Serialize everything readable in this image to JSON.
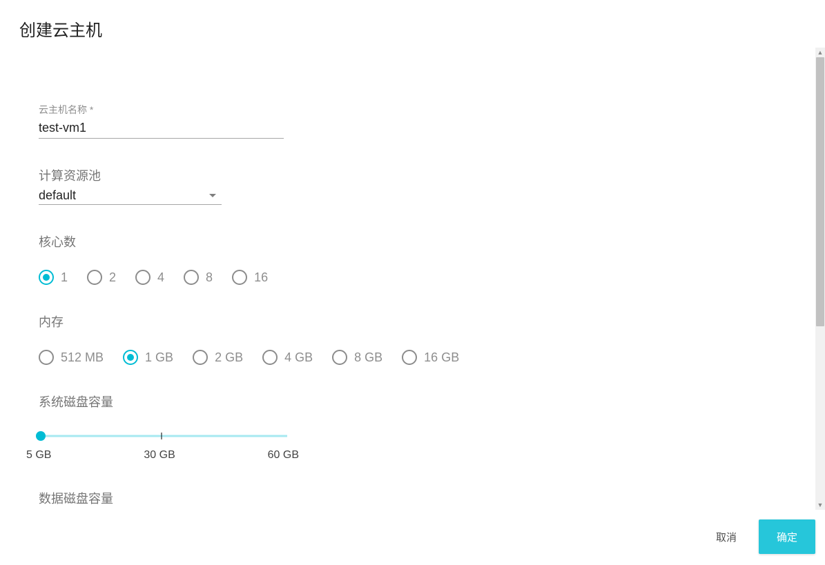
{
  "dialog": {
    "title": "创建云主机"
  },
  "form": {
    "name": {
      "label": "云主机名称 *",
      "value": "test-vm1"
    },
    "pool": {
      "label": "计算资源池",
      "value": "default"
    },
    "cores": {
      "label": "核心数",
      "selected": "1",
      "options": [
        "1",
        "2",
        "4",
        "8",
        "16"
      ]
    },
    "memory": {
      "label": "内存",
      "selected": "1 GB",
      "options": [
        "512 MB",
        "1 GB",
        "2 GB",
        "4 GB",
        "8 GB",
        "16 GB"
      ]
    },
    "sysdisk": {
      "label": "系统磁盘容量",
      "value": 5,
      "ticks": [
        "5 GB",
        "30 GB",
        "60 GB"
      ]
    },
    "datadisk": {
      "label": "数据磁盘容量"
    }
  },
  "actions": {
    "cancel": "取消",
    "confirm": "确定"
  }
}
